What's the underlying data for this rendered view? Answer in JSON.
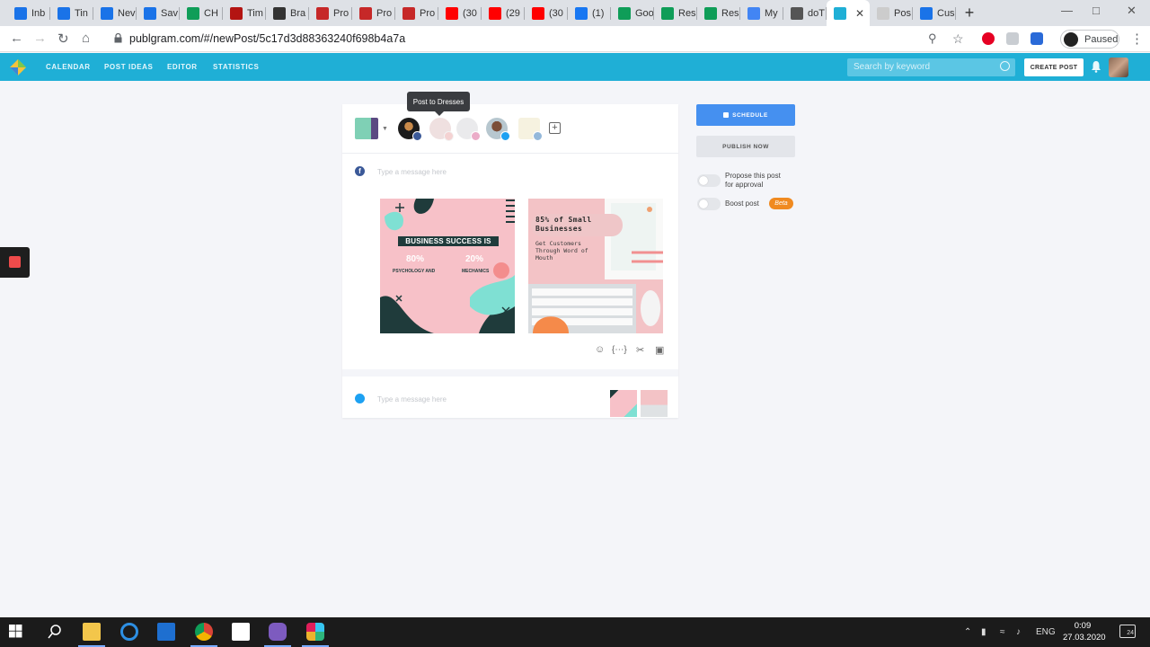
{
  "browser": {
    "tabs": [
      {
        "label": "Inb",
        "icon": "trello-icon",
        "color": "#1a73e8"
      },
      {
        "label": "Tin",
        "icon": "trello-icon",
        "color": "#1a73e8"
      },
      {
        "label": "Nev",
        "icon": "trello-icon",
        "color": "#1a73e8"
      },
      {
        "label": "Sav",
        "icon": "trello-icon",
        "color": "#1a73e8"
      },
      {
        "label": "CH",
        "icon": "sheets-icon",
        "color": "#0f9d58"
      },
      {
        "label": "Tim",
        "icon": "docs-red-icon",
        "color": "#b31412"
      },
      {
        "label": "Bra",
        "icon": "bold-b-icon",
        "color": "#333333"
      },
      {
        "label": "Pro",
        "icon": "p-icon",
        "color": "#c62828"
      },
      {
        "label": "Pro",
        "icon": "p-icon",
        "color": "#c62828"
      },
      {
        "label": "Pro",
        "icon": "p-icon",
        "color": "#c62828"
      },
      {
        "label": "(30",
        "icon": "youtube-icon",
        "color": "#ff0000"
      },
      {
        "label": "(29",
        "icon": "youtube-icon",
        "color": "#ff0000"
      },
      {
        "label": "(30",
        "icon": "youtube-icon",
        "color": "#ff0000"
      },
      {
        "label": "(1)",
        "icon": "facebook-icon",
        "color": "#1877f2"
      },
      {
        "label": "Goo",
        "icon": "sheets-icon",
        "color": "#0f9d58"
      },
      {
        "label": "Res",
        "icon": "sheets-icon",
        "color": "#0f9d58"
      },
      {
        "label": "Res",
        "icon": "sheets-icon",
        "color": "#0f9d58"
      },
      {
        "label": "My",
        "icon": "docs-icon",
        "color": "#4285f4"
      },
      {
        "label": "doT",
        "icon": "o-icon",
        "color": "#555555"
      },
      {
        "label": "",
        "icon": "publgram-icon",
        "color": "#1fafd6",
        "active": true
      },
      {
        "label": "Pos",
        "icon": "page-icon",
        "color": "#cccccc"
      },
      {
        "label": "Cus",
        "icon": "trello-icon",
        "color": "#1a73e8"
      }
    ],
    "url": "publgram.com/#/newPost/5c17d3d88363240f698b4a7a",
    "profile_label": "Paused"
  },
  "app": {
    "nav": [
      "CALENDAR",
      "POST IDEAS",
      "EDITOR",
      "STATISTICS"
    ],
    "search_placeholder": "Search by keyword",
    "create_post": "CREATE POST"
  },
  "composer": {
    "tooltip": "Post to Dresses",
    "facebook_message_placeholder": "Type a message here",
    "twitter_message_placeholder": "Type a message here",
    "image1": {
      "headline": "BUSINESS SUCCESS IS",
      "stat1_value": "80%",
      "stat1_label": "PSYCHOLOGY AND",
      "stat2_value": "20%",
      "stat2_label": "MECHANICS"
    },
    "image2": {
      "headline": "85% of Small Businesses",
      "subline": "Get Customers Through Word of Mouth"
    }
  },
  "sidebar": {
    "schedule": "SCHEDULE",
    "publish_now": "PUBLISH NOW",
    "propose_label": "Propose this post for approval",
    "boost_label": "Boost post",
    "beta": "Beta"
  },
  "taskbar": {
    "language": "ENG",
    "time": "0:09",
    "date": "27.03.2020",
    "notification_count": "24"
  }
}
